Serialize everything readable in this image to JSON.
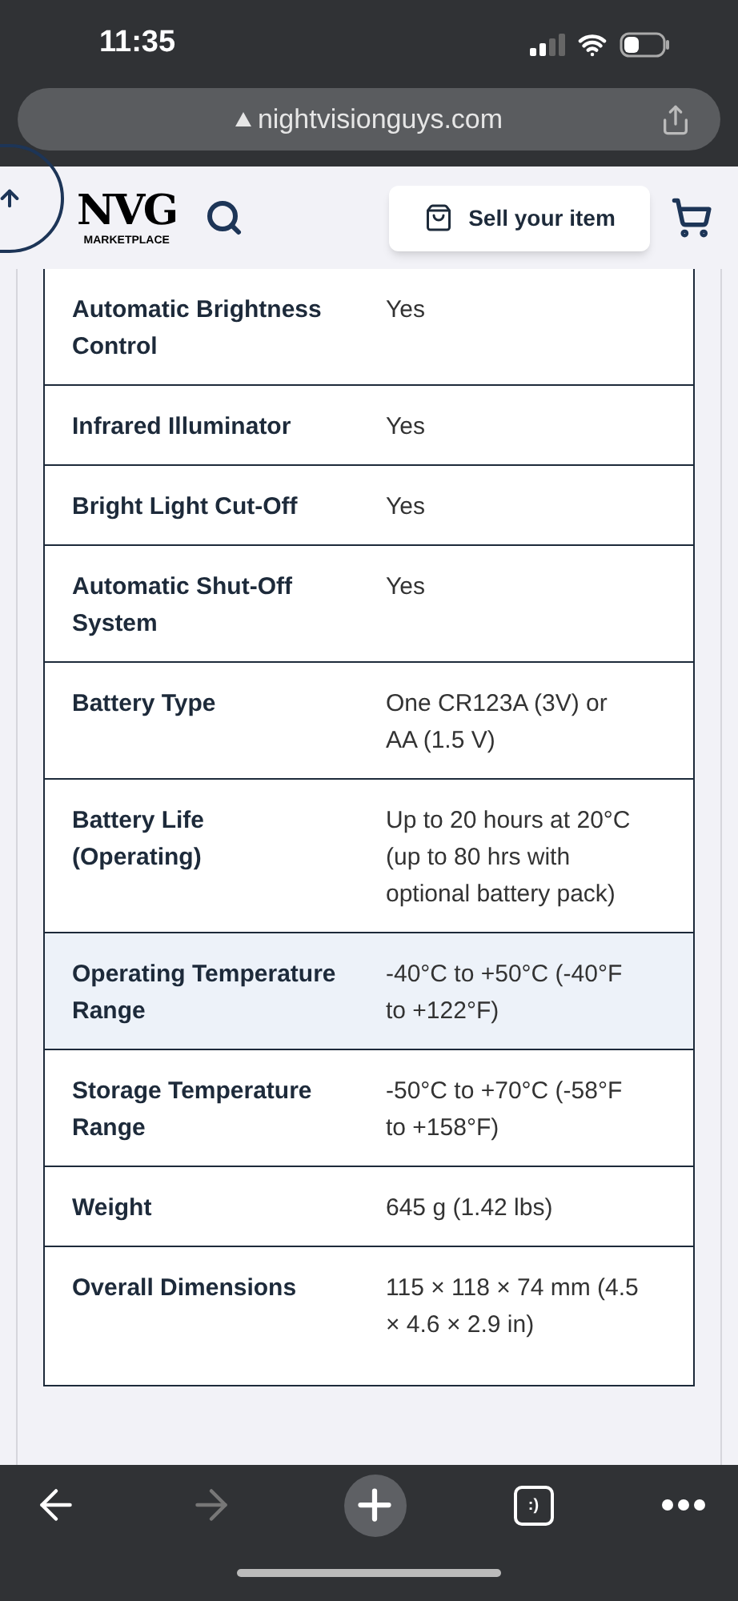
{
  "status_bar": {
    "time": "11:35"
  },
  "browser": {
    "url": "nightvisionguys.com",
    "tab_count_label": ":)",
    "forward_disabled": true
  },
  "header": {
    "logo_main": "NVG",
    "logo_sub": "MARKETPLACE",
    "sell_button": "Sell your item"
  },
  "specs": [
    {
      "label": "Automatic Brightness Control",
      "value": "Yes",
      "highlighted": false
    },
    {
      "label": "Infrared Illuminator",
      "value": "Yes",
      "highlighted": false
    },
    {
      "label": "Bright Light Cut-Off",
      "value": "Yes",
      "highlighted": false
    },
    {
      "label": "Automatic Shut-Off System",
      "value": "Yes",
      "highlighted": false
    },
    {
      "label": "Battery Type",
      "value": "One CR123A (3V) or AA (1.5 V)",
      "highlighted": false
    },
    {
      "label": "Battery Life (Operating)",
      "value": "Up to 20 hours at 20°C (up to 80 hrs with optional battery pack)",
      "highlighted": false
    },
    {
      "label": "Operating Temperature Range",
      "value": "-40°C to +50°C (-40°F to +122°F)",
      "highlighted": true
    },
    {
      "label": "Storage Temperature Range",
      "value": "-50°C to +70°C (-58°F to +158°F)",
      "highlighted": false
    },
    {
      "label": "Weight",
      "value": "645 g (1.42 lbs)",
      "highlighted": false
    },
    {
      "label": "Overall Dimensions",
      "value": "115 × 118 × 74 mm (4.5 × 4.6 × 2.9 in)",
      "highlighted": false
    }
  ]
}
